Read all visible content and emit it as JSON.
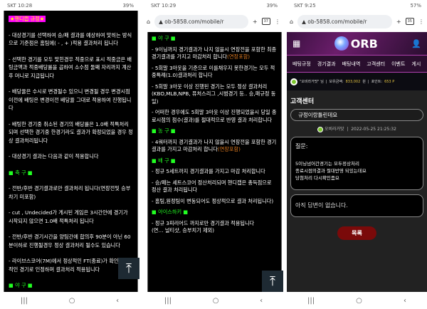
{
  "panel1": {
    "status": {
      "carrier_time": "SKT 10:28",
      "battery": "39%"
    },
    "tag": "★핸디캡 규정★",
    "paragraphs": [
      "- 대상경기를 선택하여 승/패 결과를 예상하여 맞히는 방식으로 기준점은 홈팀에( - , + )적용 결과처리 됩니다",
      "- 선택한 경기를 모두 맞힌경우 적중으로 표시 적중금은 배팅금액과 적중배당률을 곱하여 소수점 둘째 자리까지 계산 후 머니로 지급됩니다",
      "- 배당율은 수시로 변경될수 있으니 변경될 경우 변경시점 이전에 배팅은 변경이전 배당율 그대로 적용하여 진행됩니다",
      "- 배팅한 경기중 취소된 경기의 배당률은 1.0배 적특처리되며 선택한 경기중 한경기라도 결과가 확정되었을 경우 정상 결과처리됩니다",
      "- 대상경기 결과는 다음과 같이 적용합니다"
    ],
    "soccer_header": "■ 축 구 ■",
    "soccer": [
      "- 전반/후반 경기결과로만 결과처리 됩니다(연장전및 승부차기 미포함)",
      "- cut , Undecided가 게시된 게임은 3시간안에 경기가 시작되지 않으면 1.0배 적특처리 됩니다",
      "- 전반/후반 경기시간을 양팀간에 합의후 90분이 아닌 60분이하로 진행될경우 정상 결과처리 될수도 있습니다",
      "- 라이브스코어(7M)에서 정상적인 FT(종료)가 확인… 상적인 경기로 인정하며 결과처리 적용됩니다"
    ],
    "baseball_header": "■ 야 구 ■"
  },
  "panel2": {
    "status": {
      "carrier_time": "SKT 10:29",
      "battery": "39%"
    },
    "url": "ob-5858.com/mobile/r",
    "tab_count": "37",
    "baseball_header": "■ 야 구 ■",
    "baseball": [
      {
        "text": "- 9이닝까지 경기결과가 나지 않을시 연장전을 포함한 최종 경기결과를 가지고 마감처리 합니다",
        "note": "(연장포함)"
      },
      {
        "text": "- 5회말 3아웃을 기준으로 이를채우지 못한경기는 모두 적중특례(1.0)결과처리 합니다",
        "note": ""
      },
      {
        "text": "- 5회말 3아웃 이상 진행된 경기는 모두 정상 결과처리(KBO,MLB,NPB, 퓨처스리그 ,시범경기 등.. 승,패규정 동일)",
        "note": ""
      },
      {
        "text": "- 어떠한 경우에도 5회말 3아웃 이상 진행되었을시 당일 종료시점의 점수(결과)를 절대적으로 반영 결과 처리합니다",
        "note": ""
      }
    ],
    "basketball_header": "■ 농 구 ■",
    "basketball": [
      {
        "text": "- 4쿼터까지 경기결과가 나지 않을시 연장전을 포함한 경기결과를 가지고 마감처리 합니다",
        "note": "(연장포함)"
      }
    ],
    "volleyball_header": "■ 배 구 ■",
    "volleyball": [
      "- 정규 5세트까지 경기결과를 가지고 마감 처리합니다",
      "- 승/패는 세트스코어 정산처리되며 핸디캡은 총득점으로 정산 결과 처리됩니다",
      "- 홈팀,원정팀이 변동되어도 정상적으로 결과 처리됩니다)"
    ],
    "hockey_header": "■ 아이스하키 ■",
    "hockey": [
      "- 정규 3피리어드 까지로만 경기결과 적용됩니다(연… 널티샷, 승부치기 제외)"
    ]
  },
  "panel3": {
    "status": {
      "carrier_time": "SKT 9:25",
      "battery": "57%"
    },
    "url": "ob-5858.com/mobile/r",
    "tab_count": "35",
    "brand": "ORB",
    "menu": [
      "배팅규정",
      "경기결과",
      "배팅내역",
      "고객센터",
      "이벤트",
      "게시"
    ],
    "user": {
      "name": "\"오비라거맛\" 님",
      "balance_label": "보유금액:",
      "balance": "833,002",
      "balance_unit": "원",
      "points_label": "포인트:",
      "points": "653 P"
    },
    "section_title": "고객센터",
    "subject": "규정이랑틀린데요",
    "author": "오비라거맛",
    "date": "2022-05-25 21:25:32",
    "question_label": "질문:",
    "question_lines": [
      "5이닝넘어간경기는 모두정상처리",
      "종료시점의결과 절대반영 되있는데요",
      "당첨처리 다시확인좀요"
    ],
    "answer": "아직 답변이 없습니다.",
    "list_button": "목록"
  },
  "colors": {
    "header_green": "#22ff22",
    "note_orange": "#e07b20",
    "tag_bg": "#ff00ff",
    "list_button": "#7a0a0a"
  }
}
